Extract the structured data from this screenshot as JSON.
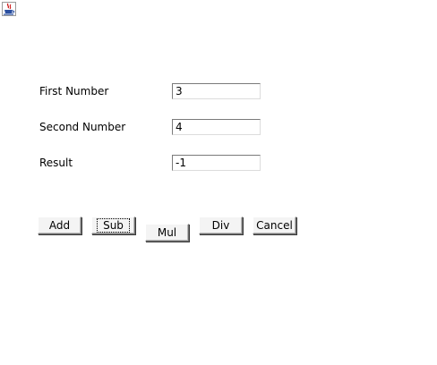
{
  "window": {
    "icon": "java-cup-icon"
  },
  "form": {
    "first_number_label": "First Number",
    "first_number_value": "3",
    "second_number_label": "Second Number",
    "second_number_value": "4",
    "result_label": "Result",
    "result_value": "-1"
  },
  "buttons": {
    "add": "Add",
    "sub": "Sub",
    "mul": "Mul",
    "div": "Div",
    "cancel": "Cancel"
  }
}
